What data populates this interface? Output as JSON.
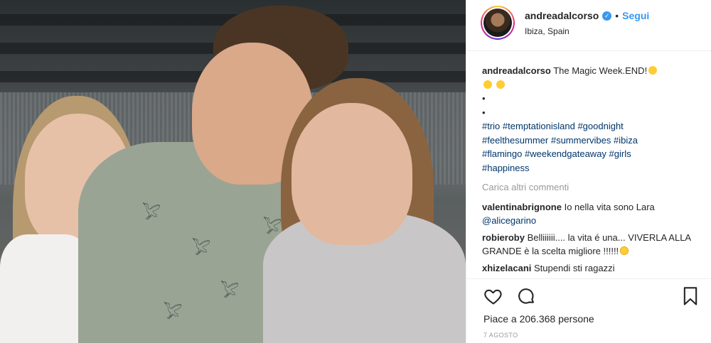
{
  "post": {
    "username": "andreadalcorso",
    "follow_label": "Segui",
    "separator": "•",
    "location": "Ibiza, Spain"
  },
  "caption": {
    "username": "andreadalcorso",
    "text": "The Magic Week.END!",
    "bullet1": "•",
    "bullet2": "•",
    "hashtags_line1": [
      "#trio",
      "#temptationisland",
      "#goodnight"
    ],
    "hashtags_line2": [
      "#feelthesummer",
      "#summervibes",
      "#ibiza"
    ],
    "hashtags_line3": [
      "#flamingo",
      "#weekendgateaway",
      "#girls"
    ],
    "hashtags_line4": [
      "#happiness"
    ]
  },
  "load_more": "Carica altri commenti",
  "comments": [
    {
      "username": "valentinabrignone",
      "text": "Io nella vita sono Lara",
      "mention": "@alicegarino"
    },
    {
      "username": "robieroby",
      "text": "Belliiiiii.... la vita é una... VIVERLA ALLA GRANDE è la scelta migliore !!!!!!"
    },
    {
      "username": "xhizelacani",
      "text": "Stupendi sti ragazzi"
    }
  ],
  "likes": "Piace a 206.368 persone",
  "date": "7 AGOSTO",
  "icons": [
    "heart-icon",
    "comment-icon",
    "bookmark-icon",
    "verified-badge-icon"
  ],
  "colors": {
    "link": "#3897f0",
    "hashtag": "#003569",
    "muted": "#999999"
  }
}
